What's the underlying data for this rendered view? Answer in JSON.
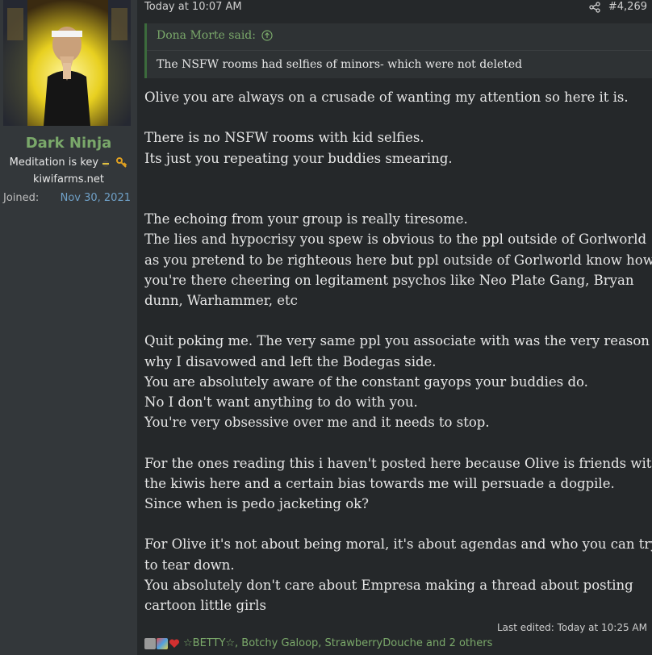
{
  "user": {
    "name": "Dark Ninja",
    "title": "Meditation is key",
    "site": "kiwifarms.net",
    "joined_label": "Joined:",
    "joined_date": "Nov 30, 2021"
  },
  "post": {
    "timestamp": "Today at 10:07 AM",
    "number": "#4,269",
    "quote_author": "Dona Morte said:",
    "quote_text": "The NSFW rooms had selfies of minors- which were not deleted",
    "lines": [
      "Olive you are always on a crusade of wanting my attention so here it is.",
      "",
      "There is no NSFW rooms with kid selfies.",
      "Its just you repeating your buddies smearing.",
      "",
      "",
      "The echoing from your group is really tiresome.",
      "The lies and hypocrisy you spew is obvious to the ppl outside of Gorlworld",
      "as you pretend to be righteous here but ppl outside of Gorlworld know how",
      "you're there cheering on legitament psychos like Neo Plate Gang, Bryan",
      "dunn, Warhammer, etc",
      "",
      "Quit poking me. The very same ppl you associate with was the very reason",
      "why I disavowed and left the Bodegas side.",
      "You are absolutely aware of the constant gayops your buddies do.",
      "No I don't want anything to do with you.",
      "You're very obsessive over me and it needs to stop.",
      "",
      "For the ones reading this i haven't posted here because Olive is friends with",
      "the kiwis here and a certain bias towards me will persuade a dogpile.",
      "Since when is pedo jacketing ok?",
      "",
      "For Olive it's not about being moral, it's about agendas and who you can try",
      "to tear down.",
      "You absolutely don't care about Empresa making a thread about posting",
      "cartoon little girls"
    ],
    "edited": "Last edited: Today at 10:25 AM",
    "reactions_text": "☆BETTY☆, Botchy Galoop, StrawberryDouche and 2 others"
  },
  "colors": {
    "username": "#7aa86a",
    "joined_date": "#6fa0c7",
    "quote_border": "#3c6b3c",
    "page_bg": "#25282a"
  },
  "icons": {
    "share": "share-icon",
    "quote_arrow": "arrow-up-circle-icon",
    "title_emojis": [
      "ninja-emoji-icon",
      "key-icon"
    ],
    "reactions": [
      "reaction-icon-1",
      "reaction-icon-2",
      "heart-icon"
    ]
  }
}
